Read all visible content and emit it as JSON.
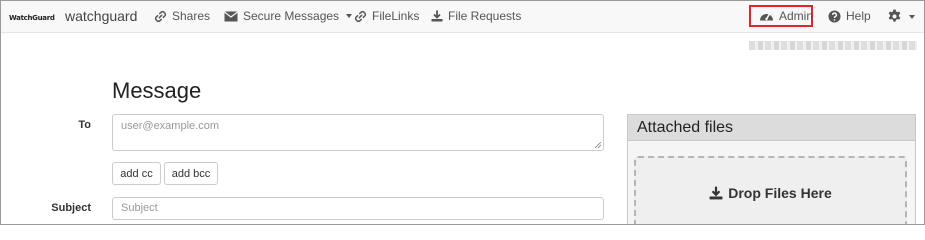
{
  "navbar": {
    "logo_text": "WatchGuard",
    "brand": "watchguard",
    "items": [
      {
        "label": "Shares",
        "icon": "link-icon"
      },
      {
        "label": "Secure Messages",
        "icon": "envelope-icon",
        "has_dropdown": true
      },
      {
        "label": "FileLinks",
        "icon": "link-icon"
      },
      {
        "label": "File Requests",
        "icon": "download-icon"
      }
    ],
    "admin": {
      "label": "Admin",
      "icon": "dashboard-icon",
      "highlight_color": "#e4232a"
    },
    "help": {
      "label": "Help",
      "icon": "question-circle-icon"
    },
    "settings": {
      "icon": "gear-icon",
      "has_dropdown": true
    }
  },
  "form": {
    "title": "Message",
    "to_label": "To",
    "to_placeholder": "user@example.com",
    "add_cc": "add cc",
    "add_bcc": "add bcc",
    "subject_label": "Subject",
    "subject_placeholder": "Subject"
  },
  "attachments": {
    "title": "Attached files",
    "drop_text": "Drop Files Here",
    "drop_icon": "download-icon"
  },
  "colors": {
    "navbar_bg": "#f8f8f8",
    "panel_header_bg": "#dcdcdc",
    "brand_red": "#d5131b"
  }
}
